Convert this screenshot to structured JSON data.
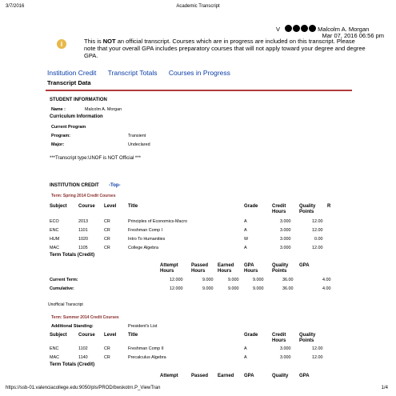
{
  "browser": {
    "print_date": "3/7/2016",
    "page_title": "Academic Transcript",
    "url": "https://ssb-01.valenciacollege.edu:9050/pls/PROD/bwskotrn.P_ViewTran",
    "page_number": "1/4"
  },
  "user": {
    "prefix": "V",
    "name": "Malcolm A. Morgan",
    "datetime": "Mar 07, 2016 06:56 pm"
  },
  "notice": {
    "icon": "info-icon",
    "part1": "This is ",
    "emphasis": "NOT",
    "part2": " an official transcript. Courses which are in progress are included on this transcript. Please note that your overall GPA includes preparatory courses that will not apply toward your degree and degree GPA."
  },
  "nav": {
    "institution_credit": "Institution Credit",
    "transcript_totals": "Transcript Totals",
    "courses_in_progress": "Courses in Progress"
  },
  "transcript_data_title": "Transcript Data",
  "student": {
    "heading": "STUDENT INFORMATION",
    "name_label": "Name :",
    "name_value": "Malcolm A. Morgan",
    "curriculum_heading": "Curriculum Information",
    "current_program_label": "Current Program",
    "program_label": "Program:",
    "program_value": "Transient",
    "major_label": "Major:",
    "major_value": "Undeclared",
    "transcript_type": "***Transcript type:UNOF is NOT Official ***"
  },
  "institution_credit": {
    "heading": "INSTITUTION CREDIT",
    "top_link": "-Top-",
    "columns": {
      "subject": "Subject",
      "course": "Course",
      "level": "Level",
      "title": "Title",
      "grade": "Grade",
      "credit_hours": "Credit Hours",
      "quality_points": "Quality Points",
      "r": "R"
    },
    "totals_columns": {
      "attempt": "Attempt Hours",
      "passed": "Passed Hours",
      "earned": "Earned Hours",
      "gpa_hours": "GPA Hours",
      "quality_points": "Quality Points",
      "gpa": "GPA"
    },
    "terms": [
      {
        "name": "Term: Spring 2014 Credit Courses",
        "courses": [
          {
            "subject": "ECO",
            "course": "2013",
            "level": "CR",
            "title": "Principles of Economics-Macro",
            "grade": "A",
            "credit": "3.000",
            "quality": "12.00"
          },
          {
            "subject": "ENC",
            "course": "1101",
            "level": "CR",
            "title": "Freshman Comp I",
            "grade": "A",
            "credit": "3.000",
            "quality": "12.00"
          },
          {
            "subject": "HUM",
            "course": "1020",
            "level": "CR",
            "title": "Intro To Humanities",
            "grade": "W",
            "credit": "3.000",
            "quality": "0.00"
          },
          {
            "subject": "MAC",
            "course": "1105",
            "level": "CR",
            "title": "College Algebra",
            "grade": "A",
            "credit": "3.000",
            "quality": "12.00"
          }
        ],
        "totals_heading": "Term Totals (Credit)",
        "current_label": "Current Term:",
        "current": {
          "attempt": "12.000",
          "passed": "9.000",
          "earned": "9.000",
          "gpa_hours": "9.000",
          "quality": "36.00",
          "gpa": "4.00"
        },
        "cumulative_label": "Cumulative:",
        "cumulative": {
          "attempt": "12.000",
          "passed": "9.000",
          "earned": "9.000",
          "gpa_hours": "9.000",
          "quality": "36.00",
          "gpa": "4.00"
        },
        "watermark": "Unofficial Transcript"
      },
      {
        "name": "Term: Summer 2014 Credit Courses",
        "standing_label": "Additional Standing:",
        "standing_value": "President's List",
        "courses": [
          {
            "subject": "ENC",
            "course": "1102",
            "level": "CR",
            "title": "Freshman Comp II",
            "grade": "A",
            "credit": "3.000",
            "quality": "12.00"
          },
          {
            "subject": "MAC",
            "course": "1140",
            "level": "CR",
            "title": "Precalculus Algebra",
            "grade": "A",
            "credit": "3.000",
            "quality": "12.00"
          }
        ],
        "totals_heading": "Term Totals (Credit)"
      }
    ]
  },
  "bottom_columns": {
    "attempt": "Attempt",
    "passed": "Passed",
    "earned": "Earned",
    "gpa": "GPA",
    "quality": "Quality",
    "gpa2": "GPA"
  }
}
